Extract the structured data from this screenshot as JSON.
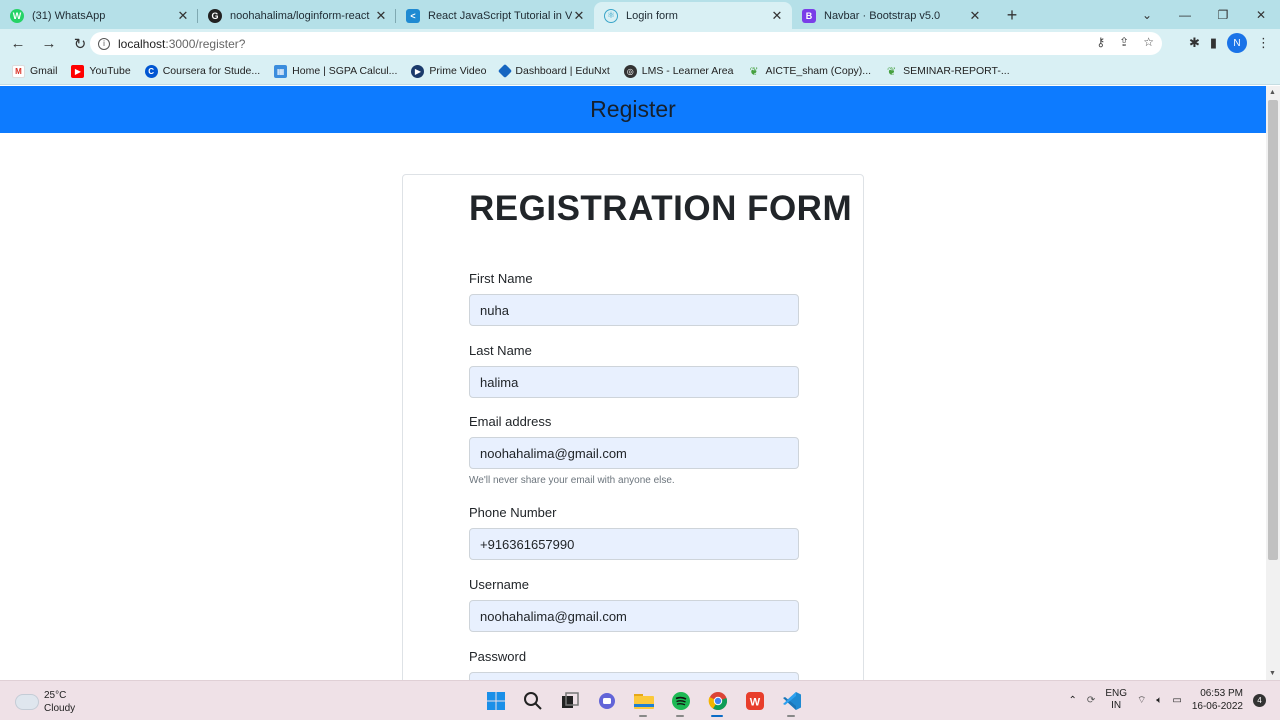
{
  "browser": {
    "tabs": [
      {
        "title": "(31) WhatsApp",
        "icon": "whatsapp-icon"
      },
      {
        "title": "noohahalima/loginform-react",
        "icon": "github-icon"
      },
      {
        "title": "React JavaScript Tutorial in Visual",
        "icon": "vscode-icon"
      },
      {
        "title": "Login form",
        "icon": "react-icon"
      },
      {
        "title": "Navbar · Bootstrap v5.0",
        "icon": "bootstrap-icon"
      }
    ],
    "url_host": "localhost",
    "url_path": ":3000/register?",
    "profile_initial": "N",
    "bookmarks": [
      {
        "label": "Gmail"
      },
      {
        "label": "YouTube"
      },
      {
        "label": "Coursera for Stude..."
      },
      {
        "label": "Home | SGPA Calcul..."
      },
      {
        "label": "Prime Video"
      },
      {
        "label": "Dashboard | EduNxt"
      },
      {
        "label": "LMS - Learner Area"
      },
      {
        "label": "AICTE_sham (Copy)..."
      },
      {
        "label": "SEMINAR-REPORT-..."
      }
    ]
  },
  "page": {
    "navbar_title": "Register",
    "form_title": "REGISTRATION FORM",
    "fields": {
      "first_name": {
        "label": "First Name",
        "value": "nuha"
      },
      "last_name": {
        "label": "Last Name",
        "value": "halima"
      },
      "email": {
        "label": "Email address",
        "value": "noohahalima@gmail.com",
        "help": "We'll never share your email with anyone else."
      },
      "phone": {
        "label": "Phone Number",
        "value": "+916361657990"
      },
      "username": {
        "label": "Username",
        "value": "noohahalima@gmail.com"
      },
      "password": {
        "label": "Password",
        "value": ""
      }
    }
  },
  "taskbar": {
    "weather_temp": "25°C",
    "weather_desc": "Cloudy",
    "lang_line1": "ENG",
    "lang_line2": "IN",
    "time": "06:53 PM",
    "date": "16-06-2022",
    "notification_count": "4"
  },
  "colors": {
    "navbar": "#0d7bff",
    "input_bg": "#e8f0fe",
    "tab_strip": "#b5e0e8"
  }
}
